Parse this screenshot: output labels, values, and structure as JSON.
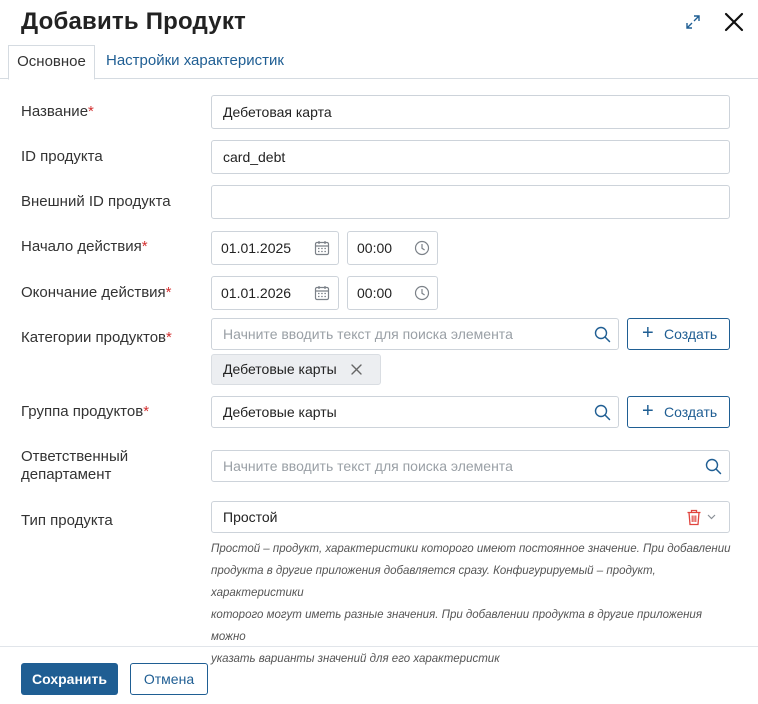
{
  "dialog": {
    "title": "Добавить Продукт"
  },
  "tabs": [
    {
      "label": "Основное",
      "active": true
    },
    {
      "label": "Настройки характеристик",
      "active": false
    }
  ],
  "form": {
    "name": {
      "label": "Название",
      "required": "*",
      "value": "Дебетовая карта"
    },
    "product_id": {
      "label": "ID продукта",
      "value": "card_debt"
    },
    "external_id": {
      "label": "Внешний ID продукта",
      "value": ""
    },
    "start": {
      "label": "Начало действия",
      "required": "*",
      "date": "01.01.2025",
      "time": "00:00"
    },
    "end": {
      "label": "Окончание действия",
      "required": "*",
      "date": "01.01.2026",
      "time": "00:00"
    },
    "categories": {
      "label": "Категории продуктов",
      "required": "*",
      "placeholder": "Начните вводить текст для поиска элемента",
      "chips": [
        "Дебетовые карты"
      ],
      "create_label": "Создать"
    },
    "group": {
      "label": "Группа продуктов",
      "required": "*",
      "value": "Дебетовые карты",
      "create_label": "Создать"
    },
    "department": {
      "label_line1": "Ответственный",
      "label_line2": "департамент",
      "placeholder": "Начните вводить текст для поиска элемента"
    },
    "product_type": {
      "label": "Тип продукта",
      "value": "Простой"
    },
    "hint_lines": [
      "Простой – продукт, характеристики которого имеют постоянное значение. При добавлении",
      "продукта в другие приложения добавляется сразу. Конфигурируемый – продукт, характеристики",
      "которого могут иметь разные значения. При добавлении продукта в другие приложения можно",
      "указать варианты значений для его характеристик"
    ]
  },
  "footer": {
    "save_label": "Сохранить",
    "cancel_label": "Отмена"
  },
  "colors": {
    "accent": "#1f5e93",
    "required": "#d32f2f",
    "delete_icon": "#e0443e"
  },
  "icons": [
    "expand-icon",
    "close-icon",
    "calendar-icon",
    "clock-icon",
    "search-icon",
    "plus-icon",
    "chip-remove-icon",
    "trash-icon",
    "chevron-down-icon"
  ]
}
